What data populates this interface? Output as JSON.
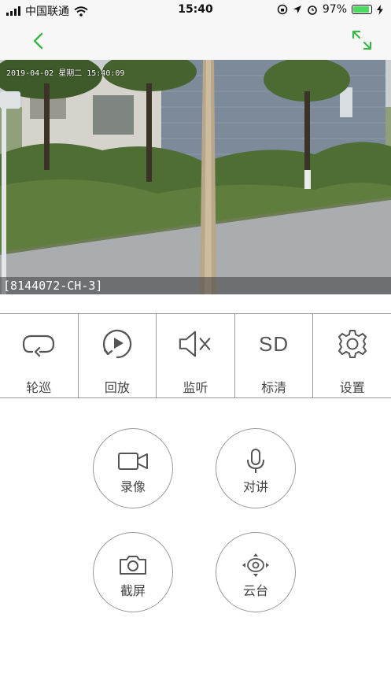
{
  "status_bar": {
    "carrier": "中国联通",
    "time": "15:40",
    "battery": "97%",
    "battery_level": 0.97
  },
  "video": {
    "osd_datetime": "2019-04-02 星期二 15:40:09",
    "camera_label": "[8144072-CH-3]"
  },
  "controls": [
    {
      "label": "轮巡",
      "icon": "patrol-loop-icon"
    },
    {
      "label": "回放",
      "icon": "playback-icon"
    },
    {
      "label": "监听",
      "icon": "speaker-muted-icon"
    },
    {
      "label": "标清",
      "icon": "sd-quality-icon",
      "icon_text": "SD"
    },
    {
      "label": "设置",
      "icon": "gear-icon"
    }
  ],
  "actions": [
    {
      "label": "录像",
      "icon": "video-camera-icon"
    },
    {
      "label": "对讲",
      "icon": "microphone-icon"
    },
    {
      "label": "截屏",
      "icon": "camera-icon"
    },
    {
      "label": "云台",
      "icon": "ptz-direction-icon"
    }
  ],
  "colors": {
    "accent": "#3cb54a",
    "border": "#9a9a9a",
    "icon": "#555555"
  }
}
